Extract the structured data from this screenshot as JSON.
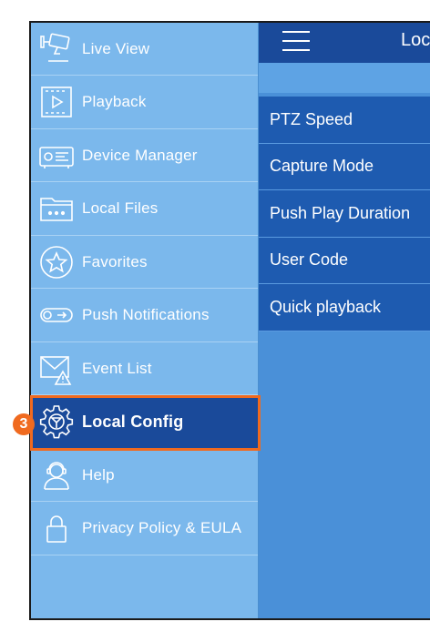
{
  "sidebar": {
    "items": [
      {
        "label": "Live View",
        "icon": "camera-icon"
      },
      {
        "label": "Playback",
        "icon": "playback-film-icon"
      },
      {
        "label": "Device Manager",
        "icon": "dvr-device-icon"
      },
      {
        "label": "Local Files",
        "icon": "folder-icon"
      },
      {
        "label": "Favorites",
        "icon": "star-icon"
      },
      {
        "label": "Push Notifications",
        "icon": "toggle-notification-icon"
      },
      {
        "label": "Event List",
        "icon": "mail-alert-icon"
      },
      {
        "label": "Local Config",
        "icon": "gear-icon"
      },
      {
        "label": "Help",
        "icon": "support-person-icon"
      },
      {
        "label": "Privacy Policy & EULA",
        "icon": "lock-icon"
      }
    ],
    "active_index": 7
  },
  "annotation": {
    "step": "3",
    "color": "#f06a1f"
  },
  "header": {
    "title": "Loc"
  },
  "config_list": {
    "items": [
      "PTZ Speed",
      "Capture Mode",
      "Push Play Duration",
      "User Code",
      "Quick playback"
    ]
  },
  "colors": {
    "sidebar_bg": "#7bb8ec",
    "active_item": "#1a4a9a",
    "content_bg": "#4a90d8",
    "list_item_bg": "#1e5bb0",
    "highlight": "#f06a1f"
  }
}
